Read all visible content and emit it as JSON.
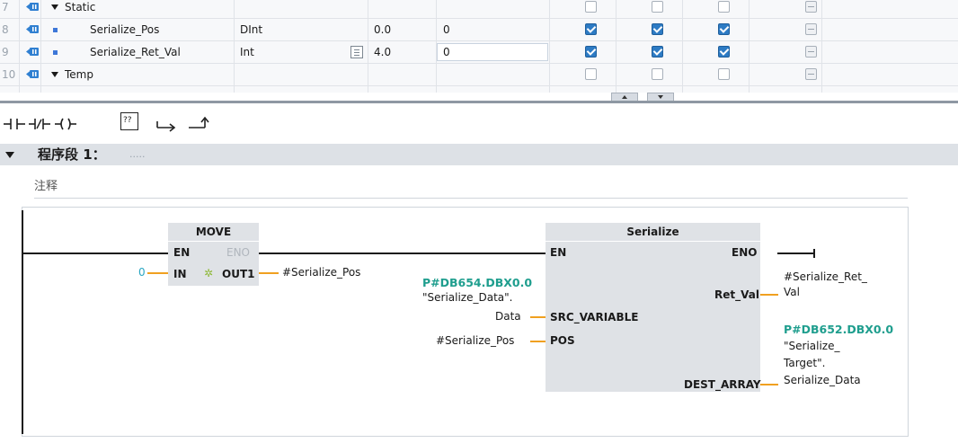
{
  "variable_table": {
    "rows": [
      {
        "no": "7",
        "name": "Static",
        "kind": "section",
        "type": "",
        "offset": "",
        "start_value": "",
        "checks": [
          false,
          false,
          false,
          false
        ]
      },
      {
        "no": "8",
        "name": "Serialize_Pos",
        "kind": "variable",
        "type": "DInt",
        "offset": "0.0",
        "start_value": "0",
        "checks": [
          true,
          true,
          true,
          false
        ]
      },
      {
        "no": "9",
        "name": "Serialize_Ret_Val",
        "kind": "variable",
        "type": "Int",
        "offset": "4.0",
        "start_value": "0",
        "checks": [
          true,
          true,
          true,
          false
        ]
      },
      {
        "no": "10",
        "name": "Temp",
        "kind": "section",
        "type": "",
        "offset": "",
        "start_value": "",
        "checks": [
          false,
          false,
          false,
          false
        ]
      }
    ]
  },
  "toolbar": {
    "icons": [
      "no-contact-icon",
      "nc-contact-icon",
      "coil-icon",
      "empty-box-icon",
      "open-branch-icon",
      "close-branch-icon"
    ],
    "empty_box_label": "??"
  },
  "network": {
    "title": "程序段 1：",
    "title_placeholder": ".....",
    "comment": "注释",
    "move": {
      "title": "MOVE",
      "en": "EN",
      "eno": "ENO",
      "in": "IN",
      "out1": "OUT1",
      "in_value": "0",
      "out1_operand": "#Serialize_Pos"
    },
    "serialize": {
      "title": "Serialize",
      "en": "EN",
      "eno": "ENO",
      "src_variable": "SRC_VARIABLE",
      "pos": "POS",
      "ret_val": "Ret_Val",
      "dest_array": "DEST_ARRAY",
      "src_addr": "P#DB654.DBX0.0",
      "src_operand_1": "\"Serialize_Data\".",
      "src_operand_2": "Data",
      "pos_operand": "#Serialize_Pos",
      "ret_operand_1": "#Serialize_Ret_",
      "ret_operand_2": "Val",
      "dest_addr": "P#DB652.DBX0.0",
      "dest_operand_1": "\"Serialize_",
      "dest_operand_2": "Target\".",
      "dest_operand_3": "Serialize_Data"
    }
  },
  "colors": {
    "wire": "#1a1a1a",
    "operand_wire": "#f0a020",
    "block_fill": "#dfe2e6",
    "address_text": "#1f9e8e",
    "check_fill": "#2d7bc4",
    "header_band": "#dde1e6"
  }
}
